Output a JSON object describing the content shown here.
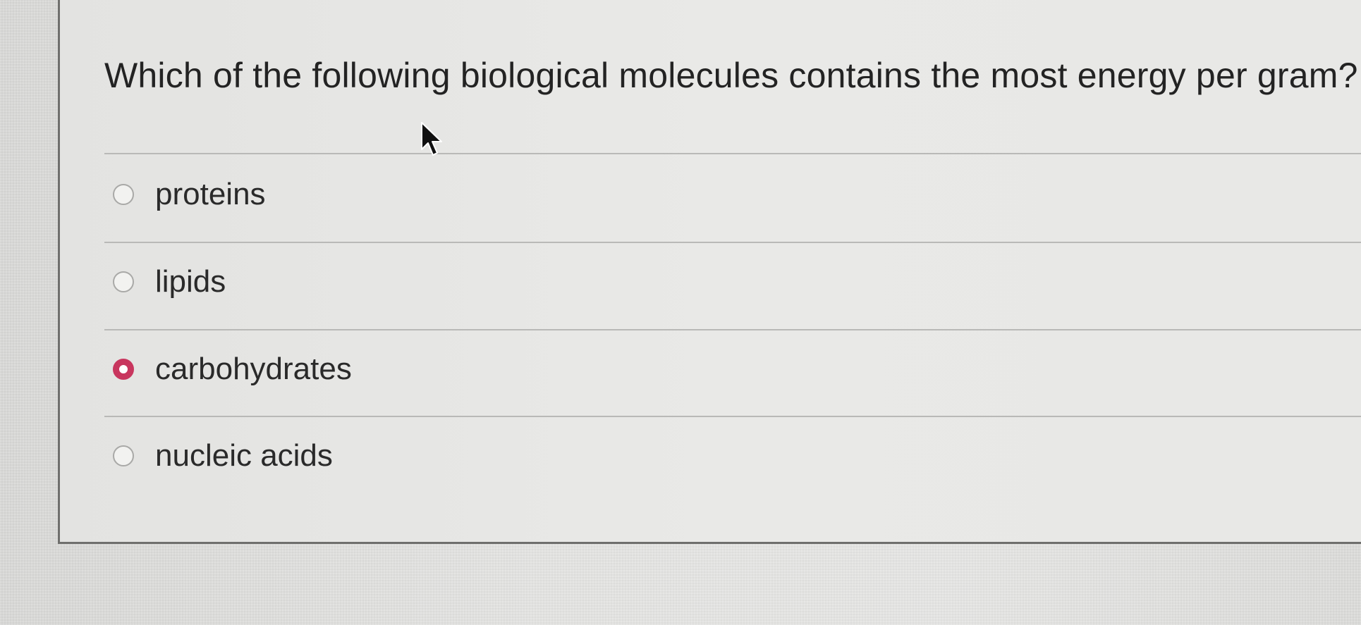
{
  "question": {
    "text": "Which of the following biological molecules contains the most energy per gram?"
  },
  "options": [
    {
      "label": "proteins",
      "selected": false
    },
    {
      "label": "lipids",
      "selected": false
    },
    {
      "label": "carbohydrates",
      "selected": true
    },
    {
      "label": "nucleic acids",
      "selected": false
    }
  ],
  "colors": {
    "selected_radio": "#c8365e",
    "text": "#232323",
    "divider": "#b9b9b7"
  },
  "icons": {
    "cursor": "mouse-pointer-icon"
  }
}
